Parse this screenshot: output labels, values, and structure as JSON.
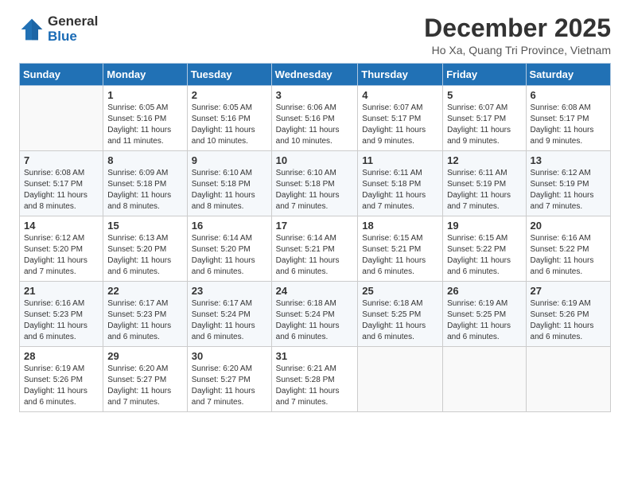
{
  "logo": {
    "general": "General",
    "blue": "Blue"
  },
  "header": {
    "month": "December 2025",
    "location": "Ho Xa, Quang Tri Province, Vietnam"
  },
  "weekdays": [
    "Sunday",
    "Monday",
    "Tuesday",
    "Wednesday",
    "Thursday",
    "Friday",
    "Saturday"
  ],
  "weeks": [
    [
      {
        "day": "",
        "info": ""
      },
      {
        "day": "1",
        "info": "Sunrise: 6:05 AM\nSunset: 5:16 PM\nDaylight: 11 hours and 11 minutes."
      },
      {
        "day": "2",
        "info": "Sunrise: 6:05 AM\nSunset: 5:16 PM\nDaylight: 11 hours and 10 minutes."
      },
      {
        "day": "3",
        "info": "Sunrise: 6:06 AM\nSunset: 5:16 PM\nDaylight: 11 hours and 10 minutes."
      },
      {
        "day": "4",
        "info": "Sunrise: 6:07 AM\nSunset: 5:17 PM\nDaylight: 11 hours and 9 minutes."
      },
      {
        "day": "5",
        "info": "Sunrise: 6:07 AM\nSunset: 5:17 PM\nDaylight: 11 hours and 9 minutes."
      },
      {
        "day": "6",
        "info": "Sunrise: 6:08 AM\nSunset: 5:17 PM\nDaylight: 11 hours and 9 minutes."
      }
    ],
    [
      {
        "day": "7",
        "info": "Sunrise: 6:08 AM\nSunset: 5:17 PM\nDaylight: 11 hours and 8 minutes."
      },
      {
        "day": "8",
        "info": "Sunrise: 6:09 AM\nSunset: 5:18 PM\nDaylight: 11 hours and 8 minutes."
      },
      {
        "day": "9",
        "info": "Sunrise: 6:10 AM\nSunset: 5:18 PM\nDaylight: 11 hours and 8 minutes."
      },
      {
        "day": "10",
        "info": "Sunrise: 6:10 AM\nSunset: 5:18 PM\nDaylight: 11 hours and 7 minutes."
      },
      {
        "day": "11",
        "info": "Sunrise: 6:11 AM\nSunset: 5:18 PM\nDaylight: 11 hours and 7 minutes."
      },
      {
        "day": "12",
        "info": "Sunrise: 6:11 AM\nSunset: 5:19 PM\nDaylight: 11 hours and 7 minutes."
      },
      {
        "day": "13",
        "info": "Sunrise: 6:12 AM\nSunset: 5:19 PM\nDaylight: 11 hours and 7 minutes."
      }
    ],
    [
      {
        "day": "14",
        "info": "Sunrise: 6:12 AM\nSunset: 5:20 PM\nDaylight: 11 hours and 7 minutes."
      },
      {
        "day": "15",
        "info": "Sunrise: 6:13 AM\nSunset: 5:20 PM\nDaylight: 11 hours and 6 minutes."
      },
      {
        "day": "16",
        "info": "Sunrise: 6:14 AM\nSunset: 5:20 PM\nDaylight: 11 hours and 6 minutes."
      },
      {
        "day": "17",
        "info": "Sunrise: 6:14 AM\nSunset: 5:21 PM\nDaylight: 11 hours and 6 minutes."
      },
      {
        "day": "18",
        "info": "Sunrise: 6:15 AM\nSunset: 5:21 PM\nDaylight: 11 hours and 6 minutes."
      },
      {
        "day": "19",
        "info": "Sunrise: 6:15 AM\nSunset: 5:22 PM\nDaylight: 11 hours and 6 minutes."
      },
      {
        "day": "20",
        "info": "Sunrise: 6:16 AM\nSunset: 5:22 PM\nDaylight: 11 hours and 6 minutes."
      }
    ],
    [
      {
        "day": "21",
        "info": "Sunrise: 6:16 AM\nSunset: 5:23 PM\nDaylight: 11 hours and 6 minutes."
      },
      {
        "day": "22",
        "info": "Sunrise: 6:17 AM\nSunset: 5:23 PM\nDaylight: 11 hours and 6 minutes."
      },
      {
        "day": "23",
        "info": "Sunrise: 6:17 AM\nSunset: 5:24 PM\nDaylight: 11 hours and 6 minutes."
      },
      {
        "day": "24",
        "info": "Sunrise: 6:18 AM\nSunset: 5:24 PM\nDaylight: 11 hours and 6 minutes."
      },
      {
        "day": "25",
        "info": "Sunrise: 6:18 AM\nSunset: 5:25 PM\nDaylight: 11 hours and 6 minutes."
      },
      {
        "day": "26",
        "info": "Sunrise: 6:19 AM\nSunset: 5:25 PM\nDaylight: 11 hours and 6 minutes."
      },
      {
        "day": "27",
        "info": "Sunrise: 6:19 AM\nSunset: 5:26 PM\nDaylight: 11 hours and 6 minutes."
      }
    ],
    [
      {
        "day": "28",
        "info": "Sunrise: 6:19 AM\nSunset: 5:26 PM\nDaylight: 11 hours and 6 minutes."
      },
      {
        "day": "29",
        "info": "Sunrise: 6:20 AM\nSunset: 5:27 PM\nDaylight: 11 hours and 7 minutes."
      },
      {
        "day": "30",
        "info": "Sunrise: 6:20 AM\nSunset: 5:27 PM\nDaylight: 11 hours and 7 minutes."
      },
      {
        "day": "31",
        "info": "Sunrise: 6:21 AM\nSunset: 5:28 PM\nDaylight: 11 hours and 7 minutes."
      },
      {
        "day": "",
        "info": ""
      },
      {
        "day": "",
        "info": ""
      },
      {
        "day": "",
        "info": ""
      }
    ]
  ]
}
